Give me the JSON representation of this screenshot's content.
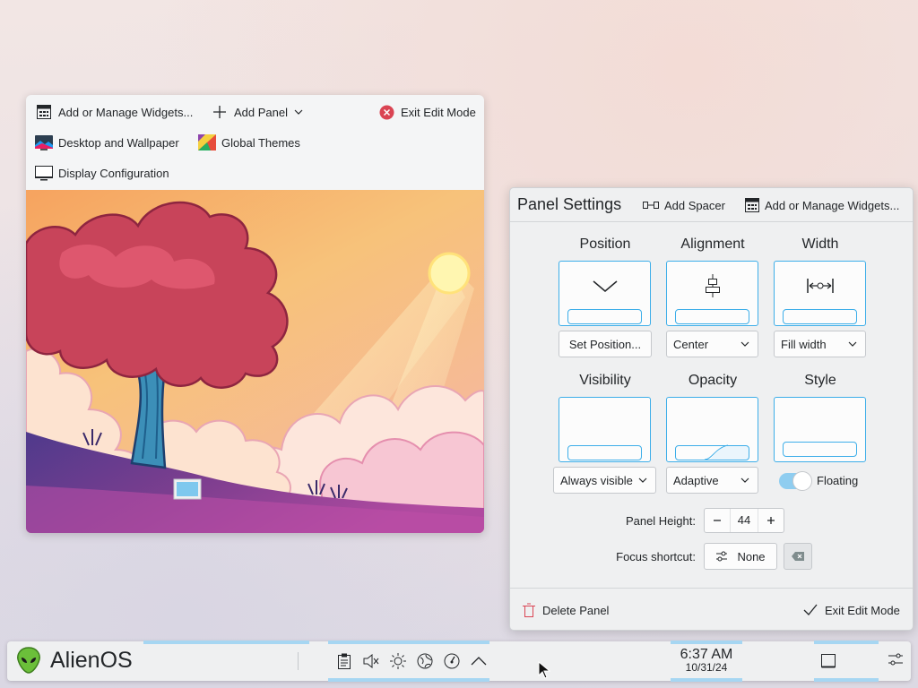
{
  "desktop_toolbar": {
    "add_widgets": "Add or Manage Widgets...",
    "add_panel": "Add Panel",
    "exit_edit_mode": "Exit Edit Mode",
    "desktop_wallpaper": "Desktop and Wallpaper",
    "global_themes": "Global Themes",
    "display_configuration": "Display Configuration"
  },
  "panel_settings": {
    "title": "Panel Settings",
    "add_spacer": "Add Spacer",
    "add_widgets": "Add or Manage Widgets...",
    "position": {
      "label": "Position",
      "value": "Set Position..."
    },
    "alignment": {
      "label": "Alignment",
      "value": "Center"
    },
    "width": {
      "label": "Width",
      "value": "Fill width"
    },
    "visibility": {
      "label": "Visibility",
      "value": "Always visible"
    },
    "opacity": {
      "label": "Opacity",
      "value": "Adaptive"
    },
    "style": {
      "label": "Style",
      "value": "Floating",
      "floating_enabled": true
    },
    "panel_height": {
      "label": "Panel Height:",
      "value": "44"
    },
    "focus_shortcut": {
      "label": "Focus shortcut:",
      "value": "None"
    },
    "delete_panel": "Delete Panel",
    "exit_edit_mode": "Exit Edit Mode"
  },
  "taskbar": {
    "launcher_label": "AlienOS",
    "tray_icons": [
      "clipboard-icon",
      "volume-muted-icon",
      "brightness-icon",
      "network-icon",
      "power-profile-icon",
      "expand-tray-icon"
    ],
    "clock": {
      "time": "6:37 AM",
      "date": "10/31/24"
    }
  },
  "colors": {
    "accent": "#3daee9",
    "danger": "#da4453",
    "panel_bg": "#eff0f1"
  }
}
